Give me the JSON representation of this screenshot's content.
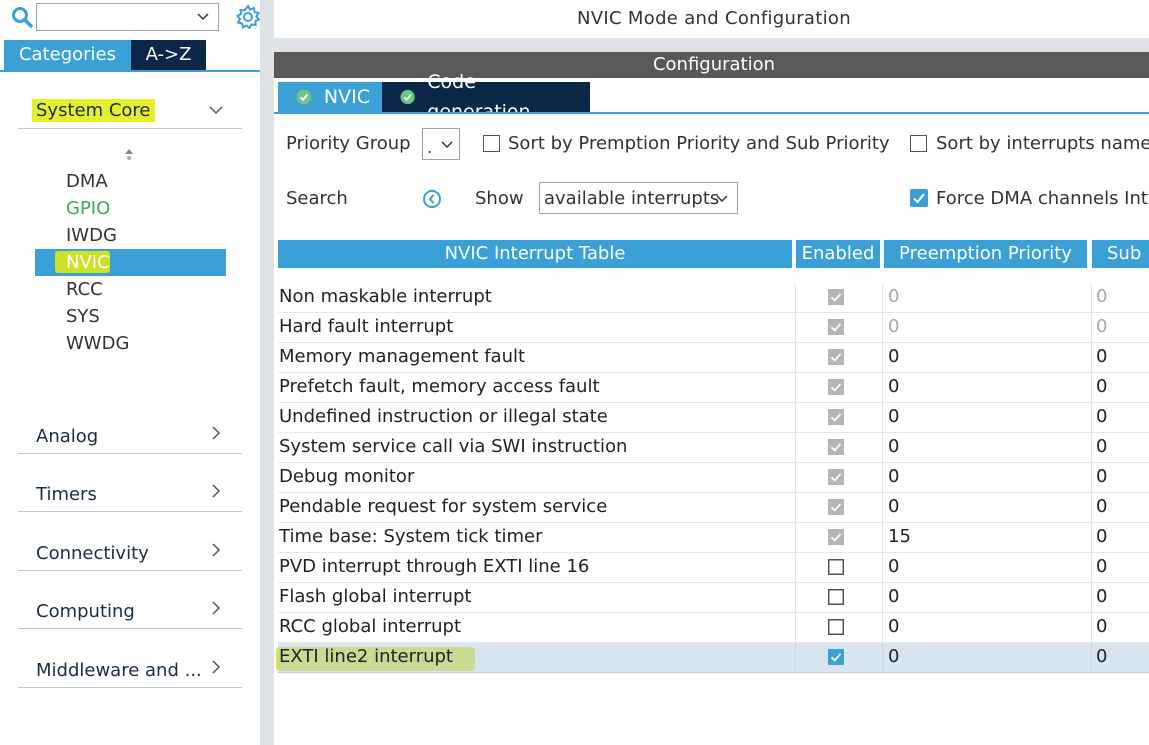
{
  "window_title": "NVIC Mode and Configuration",
  "left_panel": {
    "category_tabs": [
      {
        "label": "Categories",
        "active": true
      },
      {
        "label": "A->Z",
        "active": false
      }
    ],
    "system_core": {
      "label": "System Core",
      "items": [
        {
          "label": "DMA",
          "state": "normal"
        },
        {
          "label": "GPIO",
          "state": "green"
        },
        {
          "label": "IWDG",
          "state": "normal"
        },
        {
          "label": "NVIC",
          "state": "selected"
        },
        {
          "label": "RCC",
          "state": "normal"
        },
        {
          "label": "SYS",
          "state": "normal"
        },
        {
          "label": "WWDG",
          "state": "normal"
        }
      ]
    },
    "groups": [
      "Analog",
      "Timers",
      "Connectivity",
      "Computing",
      "Middleware and ..."
    ]
  },
  "config_header": "Configuration",
  "tabs": [
    {
      "label": "NVIC",
      "active": true
    },
    {
      "label": "Code generation",
      "active": false
    }
  ],
  "controls": {
    "priority_group_label": "Priority Group",
    "priority_group_value": ".",
    "sort_preemption_label": "Sort by Premption Priority and Sub Priority",
    "sort_names_label": "Sort by interrupts names",
    "search_label": "Search",
    "show_label": "Show",
    "show_value": "available interrupts",
    "force_dma_label": "Force DMA channels Interrupts"
  },
  "table": {
    "headers": [
      "NVIC Interrupt Table",
      "Enabled",
      "Preemption Priority",
      "Sub"
    ],
    "rows": [
      {
        "name": "Non maskable interrupt",
        "enabled": true,
        "locked": true,
        "preemption": "0",
        "sub": "0",
        "muted": true
      },
      {
        "name": "Hard fault interrupt",
        "enabled": true,
        "locked": true,
        "preemption": "0",
        "sub": "0",
        "muted": true
      },
      {
        "name": "Memory management fault",
        "enabled": true,
        "locked": true,
        "preemption": "0",
        "sub": "0",
        "muted": false
      },
      {
        "name": "Prefetch fault, memory access fault",
        "enabled": true,
        "locked": true,
        "preemption": "0",
        "sub": "0",
        "muted": false
      },
      {
        "name": "Undefined instruction or illegal state",
        "enabled": true,
        "locked": true,
        "preemption": "0",
        "sub": "0",
        "muted": false
      },
      {
        "name": "System service call via SWI instruction",
        "enabled": true,
        "locked": true,
        "preemption": "0",
        "sub": "0",
        "muted": false
      },
      {
        "name": "Debug monitor",
        "enabled": true,
        "locked": true,
        "preemption": "0",
        "sub": "0",
        "muted": false
      },
      {
        "name": "Pendable request for system service",
        "enabled": true,
        "locked": true,
        "preemption": "0",
        "sub": "0",
        "muted": false
      },
      {
        "name": "Time base: System tick timer",
        "enabled": true,
        "locked": true,
        "preemption": "15",
        "sub": "0",
        "muted": false
      },
      {
        "name": "PVD interrupt through EXTI line 16",
        "enabled": false,
        "locked": false,
        "preemption": "0",
        "sub": "0",
        "muted": false
      },
      {
        "name": "Flash global interrupt",
        "enabled": false,
        "locked": false,
        "preemption": "0",
        "sub": "0",
        "muted": false
      },
      {
        "name": "RCC global interrupt",
        "enabled": false,
        "locked": false,
        "preemption": "0",
        "sub": "0",
        "muted": false
      },
      {
        "name": "EXTI line2 interrupt",
        "enabled": true,
        "locked": false,
        "preemption": "0",
        "sub": "0",
        "muted": false,
        "selected": true
      }
    ]
  },
  "colors": {
    "accent": "#3aa0d6",
    "dark_tab": "#0a2747",
    "highlight": "#d7e51e",
    "selected_row": "#b8cde3"
  },
  "icons": {
    "search": "search-icon",
    "settings": "gear-icon",
    "refresh": "refresh-icon",
    "tab_status": "check-circle-icon"
  }
}
